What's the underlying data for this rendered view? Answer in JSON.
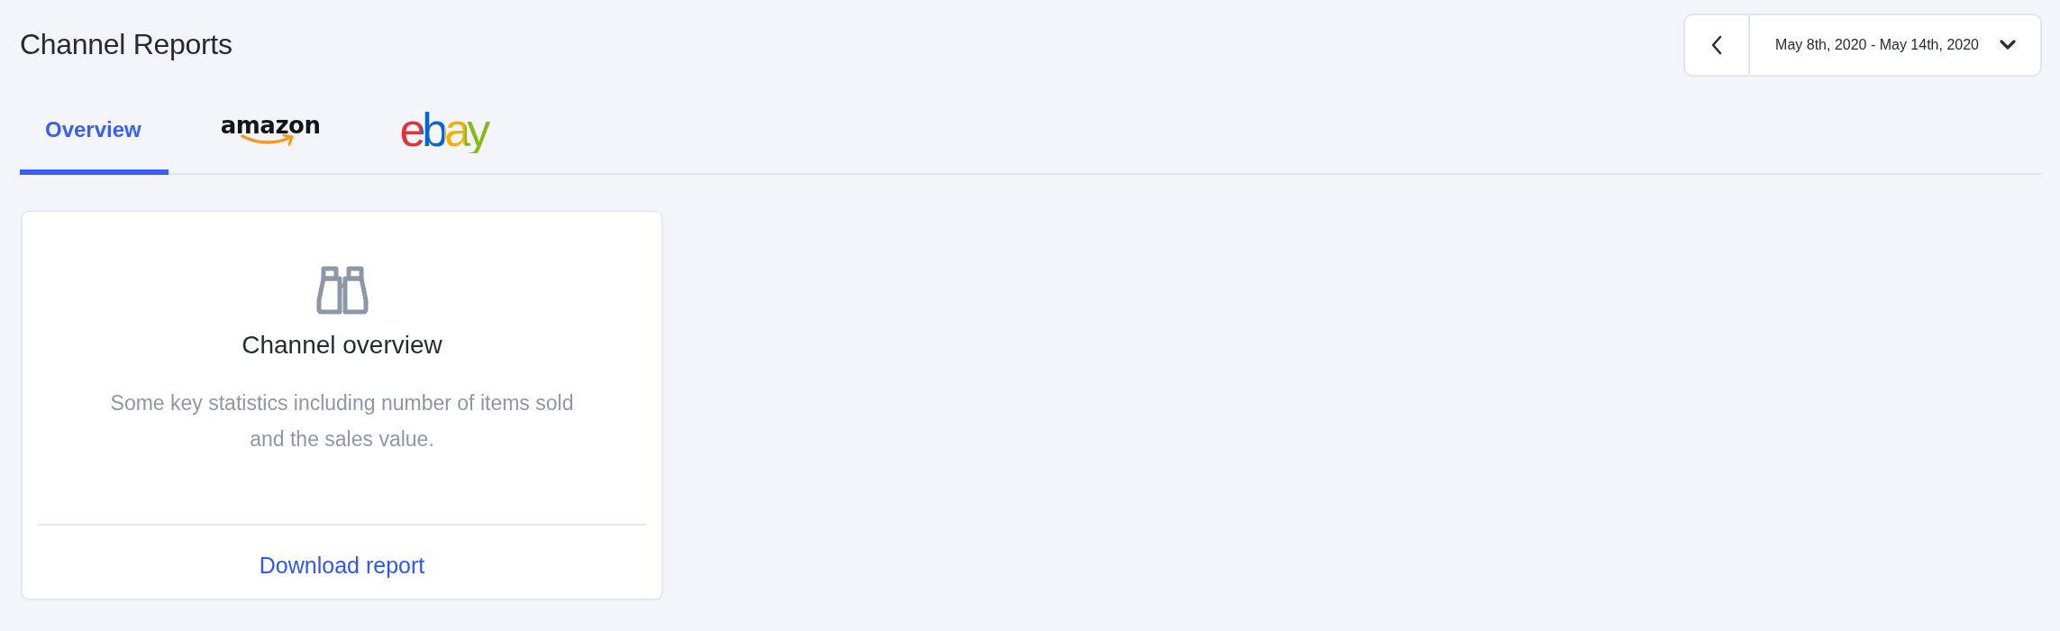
{
  "page": {
    "title": "Channel Reports"
  },
  "date_range": {
    "label": "May 8th, 2020 - May 14th, 2020"
  },
  "tabs": [
    {
      "kind": "text",
      "label": "Overview",
      "selected": true
    },
    {
      "kind": "amazon",
      "label": "amazon",
      "selected": false
    },
    {
      "kind": "ebay",
      "label": "ebay",
      "selected": false
    }
  ],
  "report_cards": [
    {
      "title": "Channel overview",
      "description": "Some key statistics including number of items sold and the sales value.",
      "link": "Download report"
    }
  ]
}
